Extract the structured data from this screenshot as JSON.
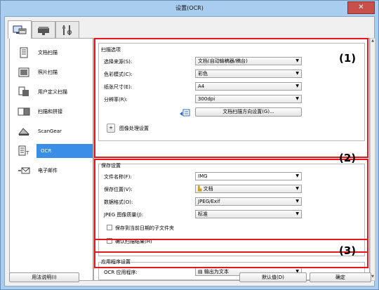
{
  "window": {
    "title": "设置(OCR)",
    "close_label": "✕"
  },
  "sidebar": {
    "items": [
      {
        "label": "文档扫描"
      },
      {
        "label": "照片扫描"
      },
      {
        "label": "用户定义扫描"
      },
      {
        "label": "扫描和拼接"
      },
      {
        "label": "ScanGear"
      },
      {
        "label": "OCR"
      },
      {
        "label": "电子邮件"
      }
    ]
  },
  "scan_options": {
    "title": "扫描选项",
    "source_label": "选择来源(S):",
    "source_value": "文档(自动输稿器/稿台)",
    "color_label": "色彩模式(C):",
    "color_value": "彩色",
    "paper_label": "纸张尺寸(E):",
    "paper_value": "A4",
    "resolution_label": "分辨率(R):",
    "resolution_value": "300dpi",
    "orientation_button": "文档扫描方向设置(G)...",
    "image_processing_label": "图像处理设置",
    "expand_symbol": "+"
  },
  "save_settings": {
    "title": "保存设置",
    "filename_label": "文件名称(F):",
    "filename_value": "IMG",
    "location_label": "保存位置(V):",
    "location_value": "文档",
    "format_label": "数据格式(O):",
    "format_value": "JPEG/Exif",
    "jpeg_quality_label": "JPEG 图像质量(J):",
    "jpeg_quality_value": "标准",
    "subfolder_label": "保存到当前日期的子文件夹",
    "confirm_label": "确认扫描结果(H)"
  },
  "app_settings": {
    "title": "应用程序设置",
    "ocr_app_label": "OCR 应用程序:",
    "ocr_app_value": "输出为文本"
  },
  "callouts": {
    "one": "(1)",
    "two": "(2)",
    "three": "(3)"
  },
  "footer": {
    "help": "用法说明(I)",
    "defaults": "默认值(D)",
    "ok": "确定"
  },
  "colors": {
    "accent": "#3a8ee6",
    "callout_red": "#e8151b"
  }
}
